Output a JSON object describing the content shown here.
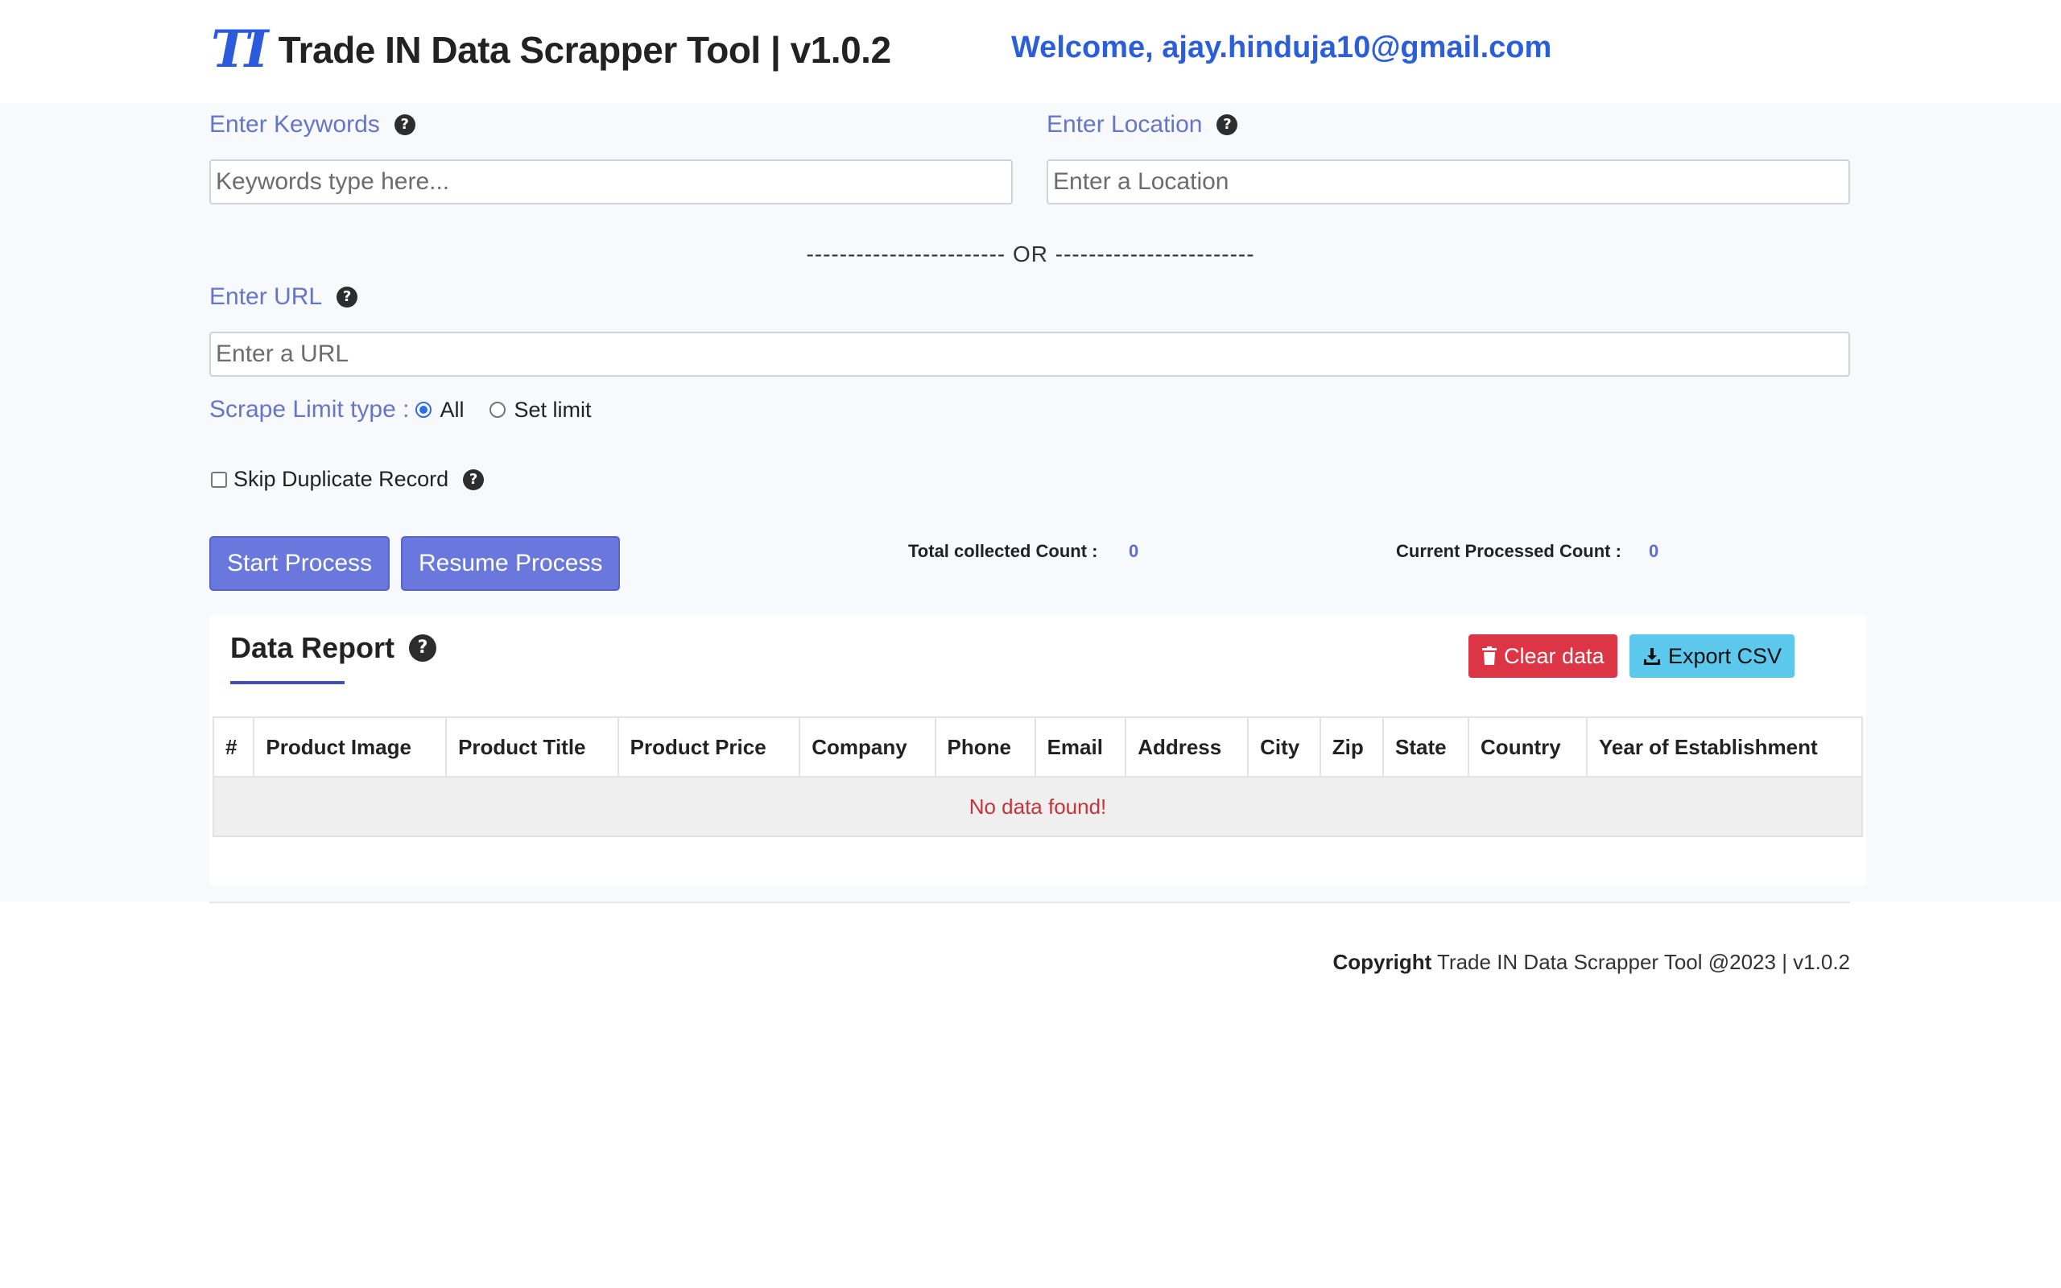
{
  "header": {
    "logo_mark": "TI",
    "title": "Trade IN Data Scrapper Tool | v1.0.2",
    "welcome": "Welcome, ajay.hinduja10@gmail.com"
  },
  "form": {
    "keywords_label": "Enter Keywords",
    "keywords_placeholder": "Keywords type here...",
    "location_label": "Enter Location",
    "location_placeholder": "Enter a Location",
    "or_text": "------------------------ OR ------------------------",
    "url_label": "Enter URL",
    "url_placeholder": "Enter a URL",
    "scrape_limit_label": "Scrape Limit type :",
    "option_all": "All",
    "option_set_limit": "Set limit",
    "skip_duplicate_label": "Skip Duplicate Record"
  },
  "actions": {
    "start": "Start Process",
    "resume": "Resume Process"
  },
  "counts": {
    "total_label": "Total collected Count :",
    "total_value": "0",
    "current_label": "Current Processed Count :",
    "current_value": "0"
  },
  "report": {
    "title": "Data Report",
    "clear_label": "Clear data",
    "export_label": "Export CSV",
    "columns": [
      "#",
      "Product Image",
      "Product Title",
      "Product Price",
      "Company",
      "Phone",
      "Email",
      "Address",
      "City",
      "Zip",
      "State",
      "Country",
      "Year of Establishment"
    ],
    "empty_message": "No data found!"
  },
  "footer": {
    "copyright_bold": "Copyright",
    "copyright_text": " Trade IN Data Scrapper Tool @2023 | v1.0.2"
  },
  "colors": {
    "accent": "#6a78dd",
    "danger": "#dc3545",
    "info": "#5bc8ec",
    "label": "#6576c9"
  }
}
